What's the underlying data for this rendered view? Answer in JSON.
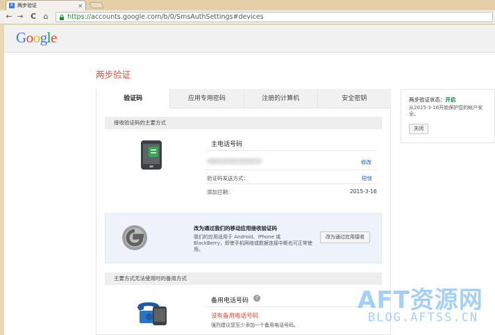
{
  "browser": {
    "tab_title": "两步验证",
    "tab_close": "×",
    "url_scheme": "https://",
    "url_rest": "accounts.google.com/b/0/SmsAuthSettings#devices",
    "back": "←",
    "forward": "→",
    "reload": "C",
    "home": "⌂"
  },
  "header": {
    "logo": "Google"
  },
  "page": {
    "title": "两步验证"
  },
  "tabs": [
    "验证码",
    "应用专用密码",
    "注册的计算机",
    "安全密钥"
  ],
  "primary": {
    "section_title": "接收验证码的主要方式",
    "heading": "主电话号码",
    "phone_masked": "•••• •••• ••••",
    "edit_link": "修改",
    "method_label": "验证码发送方式：",
    "method_value": "短信",
    "added_label": "添加日期：",
    "added_date": "2015-3-16"
  },
  "promo": {
    "title": "改为通过我们的移动应用接收验证码",
    "body": "我们的应用适用于 Android、iPhone 或 BlackBerry，即使手机网络或数据连接中断也可正常使用。",
    "button": "改为通过应用接收"
  },
  "backup": {
    "section_title": "主要方式无法使用时的备用方式",
    "heading": "备用电话号码",
    "help_icon": "?",
    "none_text": "没有备用电话号码",
    "hint": "强烈建议您至少添加一个备用电话号码。"
  },
  "status": {
    "label": "两步验证状态：",
    "value": "开启",
    "desc": "从2015-3-16开始保护您的帐户安全。",
    "button": "关闭"
  },
  "watermark": {
    "line1": "AFT资源网",
    "line2": "BLOG.AFTSS.CN"
  },
  "colors": {
    "accent_red": "#dd4b39",
    "link_blue": "#1155cc",
    "status_green": "#0b8043"
  }
}
